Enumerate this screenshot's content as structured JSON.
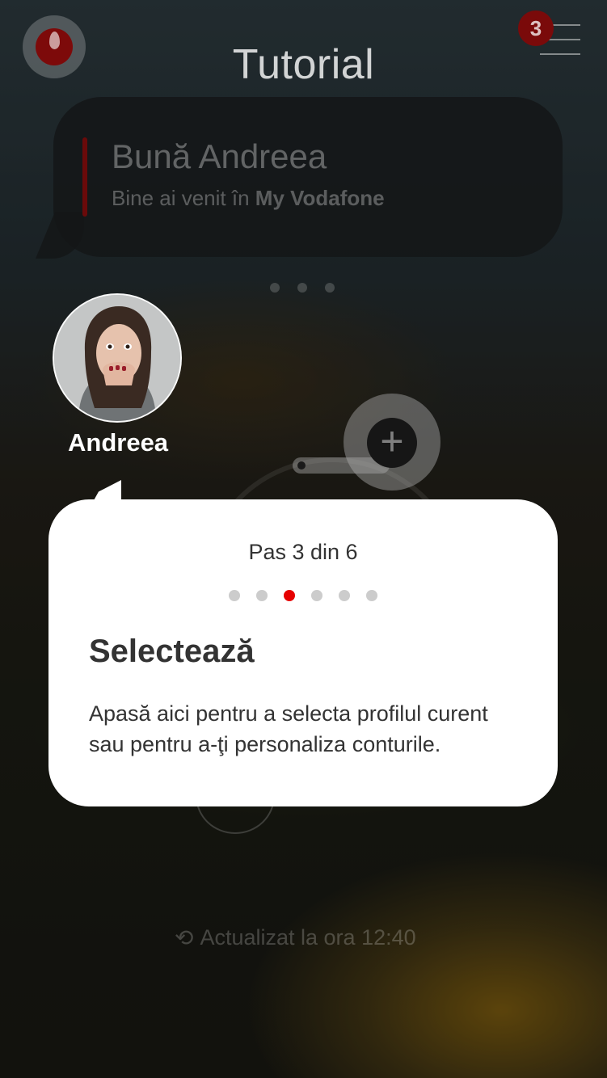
{
  "header": {
    "title": "Tutorial",
    "notification_count": "3"
  },
  "greeting": {
    "hello": "Bună Andreea",
    "welcome_prefix": "Bine ai venit în ",
    "welcome_brand": "My Vodafone"
  },
  "profile": {
    "name": "Andreea"
  },
  "tutorial": {
    "step_text": "Pas 3 din 6",
    "current_step": 3,
    "total_steps": 6,
    "title": "Selectează",
    "description": "Apasă aici pentru a selecta profilul curent sau pentru a-ţi personaliza conturile."
  },
  "status": {
    "updated_text": "Actualizat la ora 12:40"
  },
  "colors": {
    "brand_red": "#e60000",
    "card_bg": "#ffffff",
    "text_dark": "#333333"
  },
  "icons": {
    "logo": "vodafone-logo",
    "menu": "hamburger-menu-icon",
    "add": "plus-icon",
    "refresh": "refresh-icon",
    "chat": "chat-icon"
  }
}
